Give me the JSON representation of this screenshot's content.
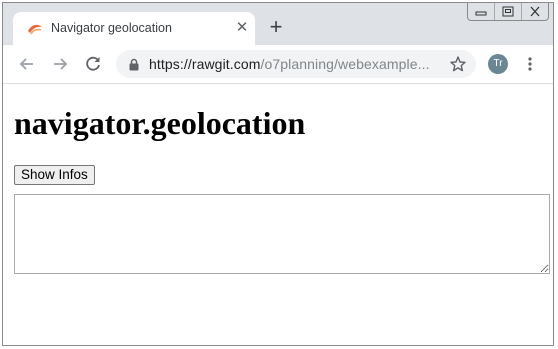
{
  "browser": {
    "tab": {
      "title": "Navigator geolocation",
      "close_label": "✕"
    },
    "new_tab_label": "+",
    "address_bar": {
      "url_host": "https://rawgit.com",
      "url_path": "/o7planning/webexample..."
    },
    "profile_initials": "Tr"
  },
  "page": {
    "heading": "navigator.geolocation",
    "show_button_label": "Show Infos",
    "info_area_value": ""
  },
  "colors": {
    "tabstrip": "#dee1e6",
    "omnibox": "#f1f3f4",
    "avatar": "#6b8793",
    "favicon": "#e8683d"
  },
  "icons": {
    "back": "arrow-left-icon",
    "forward": "arrow-right-icon",
    "reload": "reload-icon",
    "lock": "lock-icon",
    "bookmark": "star-icon",
    "menu": "kebab-menu-icon",
    "minimize": "minimize-icon",
    "restore": "restore-icon",
    "close": "close-icon"
  }
}
